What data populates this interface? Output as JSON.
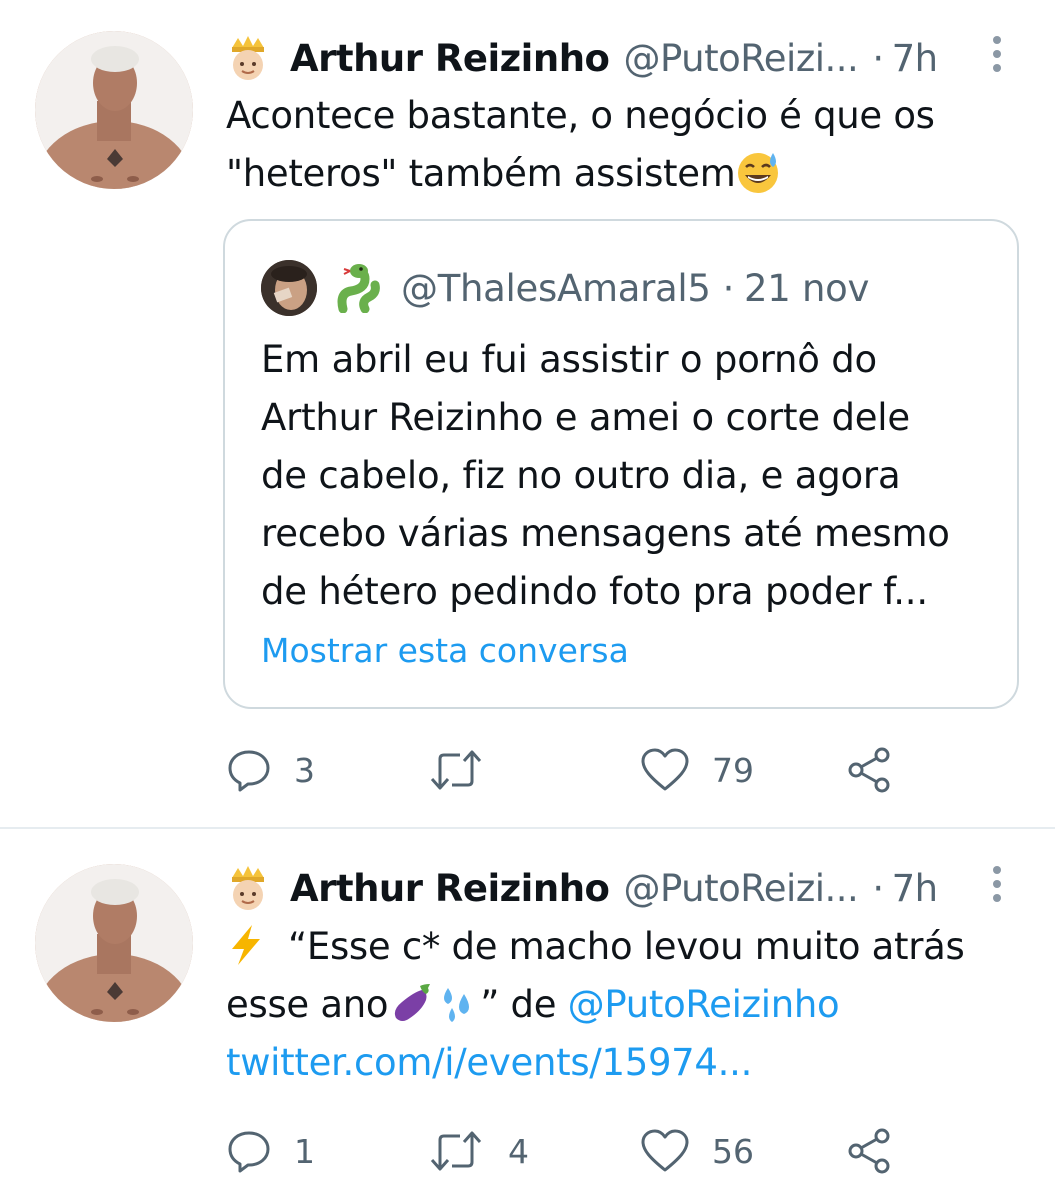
{
  "tweets": [
    {
      "author_name": "Arthur Reizinho",
      "author_handle": "@PutoReizi...",
      "separator": "·",
      "time": "7h",
      "text_lines": [
        "Acontece bastante, o negócio é que os",
        "\"heteros\" também assistem"
      ],
      "text_emoji": "grinning-sweat-emoji",
      "quote": {
        "handle": "@ThalesAmaral5",
        "separator": "·",
        "date": "21 nov",
        "text_lines": [
          "Em abril eu fui assistir o pornô do",
          "Arthur Reizinho e amei o corte dele",
          "de cabelo, fiz no outro dia, e agora",
          "recebo várias mensagens até mesmo",
          "de hétero pedindo foto pra poder f..."
        ],
        "show_conversation": "Mostrar esta conversa"
      },
      "actions": {
        "replies": "3",
        "retweets": "",
        "likes": "79"
      }
    },
    {
      "author_name": "Arthur Reizinho",
      "author_handle": "@PutoReizi...",
      "separator": "·",
      "time": "7h",
      "line1": "“Esse c* de macho levou muito atrás",
      "line2_start": "esse ano",
      "line2_mid": "” de ",
      "mention": "@PutoReizinho",
      "url": "twitter.com/i/events/15974...",
      "actions": {
        "replies": "1",
        "retweets": "4",
        "likes": "56"
      }
    }
  ],
  "colors": {
    "text": "#0f1419",
    "secondary": "#536471",
    "link": "#1d9bf0",
    "border": "#cfd9de"
  }
}
